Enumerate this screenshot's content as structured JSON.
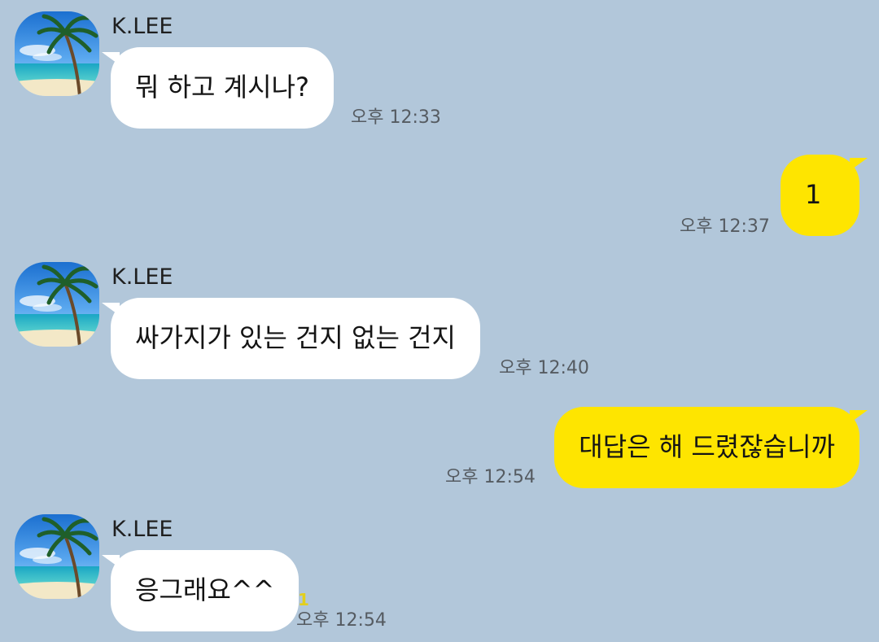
{
  "chat": {
    "messages": [
      {
        "direction": "in",
        "sender": "K.LEE",
        "avatar": "beach-palm-avatar",
        "text": "뭐 하고 계시나?",
        "time": "오후 12:33"
      },
      {
        "direction": "out",
        "text": "1",
        "time": "오후 12:37"
      },
      {
        "direction": "in",
        "sender": "K.LEE",
        "avatar": "beach-palm-avatar",
        "text": "싸가지가 있는 건지 없는 건지",
        "time": "오후 12:40"
      },
      {
        "direction": "out",
        "text": "대답은 해 드렸잖습니까",
        "time": "오후 12:54"
      },
      {
        "direction": "in",
        "sender": "K.LEE",
        "avatar": "beach-palm-avatar",
        "text": "응그래요^^",
        "time": "오후 12:54",
        "unread_count": "1"
      }
    ]
  },
  "colors": {
    "background": "#b2c7da",
    "incoming_bubble": "#ffffff",
    "outgoing_bubble": "#fee500",
    "unread": "#e3cf1c",
    "time_text": "#555b61"
  }
}
